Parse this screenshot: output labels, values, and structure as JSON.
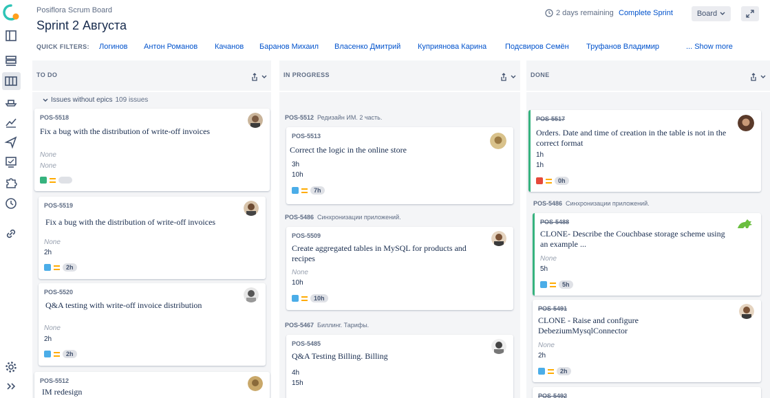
{
  "header": {
    "project": "Posiflora Scrum Board",
    "sprint_title": "Sprint 2 Августа",
    "remaining": "2 days remaining",
    "complete_sprint": "Complete Sprint",
    "board_button": "Board"
  },
  "quick_filters": {
    "label": "QUICK FILTERS:",
    "items": [
      "Логинов",
      "Антон Романов",
      "Качанов",
      "Баранов Михаил",
      "Власенко Дмитрий",
      "Куприянова Карина",
      "Подсвиров Семён",
      "Труфанов Владимир"
    ],
    "show_more": "... Show more"
  },
  "columns": {
    "todo": "TO DO",
    "in_progress": "IN PROGRESS",
    "done": "DONE"
  },
  "swimlane": {
    "label": "Issues without epics",
    "count": "109 issues"
  },
  "todo_cards": [
    {
      "key": "POS-5518",
      "summary": "Fix a bug with the distribution of write-off invoices",
      "f1": "None",
      "f2": "None"
    },
    {
      "key": "POS-5519",
      "summary": "Fix a bug with the distribution of write-off invoices",
      "f1": "None",
      "f2": "2h",
      "est": "2h"
    },
    {
      "key": "POS-5520",
      "summary": "Q&A testing with write-off invoice distribution",
      "f1": "None",
      "f2": "2h",
      "est": "2h"
    },
    {
      "key": "POS-5512",
      "summary": "IM redesign"
    }
  ],
  "progress_groups": [
    {
      "key": "POS-5512",
      "name": "Редизайн ИМ. 2 часть."
    },
    {
      "key": "POS-5486",
      "name": "Синхронизации приложений."
    },
    {
      "key": "POS-5467",
      "name": "Биллинг. Тарифы."
    }
  ],
  "progress_cards": [
    {
      "key": "POS-5513",
      "summary": "Correct the logic in the online store",
      "f1": "3h",
      "f2": "10h",
      "est": "7h"
    },
    {
      "key": "POS-5509",
      "summary": "Create aggregated tables in MySQL for products and recipes",
      "f1": "None",
      "f2": "10h",
      "est": "10h"
    },
    {
      "key": "POS-5485",
      "summary": "Q&A Testing Billing. Billing",
      "f1": "4h",
      "f2": "15h"
    }
  ],
  "done_group": {
    "key": "POS-5486",
    "name": "Синхронизации приложений."
  },
  "done_cards": [
    {
      "key": "POS-5517",
      "summary": "Orders. Date and time of creation in the table is not in the correct format",
      "f1": "1h",
      "f2": "1h",
      "est": "0h"
    },
    {
      "key": "POS-5488",
      "summary": "CLONE- Describe the Couchbase storage scheme using an example ...",
      "f1": "None",
      "f2": "5h",
      "est": "5h"
    },
    {
      "key": "POS-5491",
      "summary": "CLONE - Raise and configure DebeziumMysqlConnector",
      "f1": "None",
      "f2": "2h",
      "est": "2h"
    },
    {
      "key": "POS-5492"
    }
  ],
  "colors": {
    "accent": "#0052cc",
    "done": "#36b37e",
    "bug": "#e5493a",
    "priority": "#ffab00"
  }
}
